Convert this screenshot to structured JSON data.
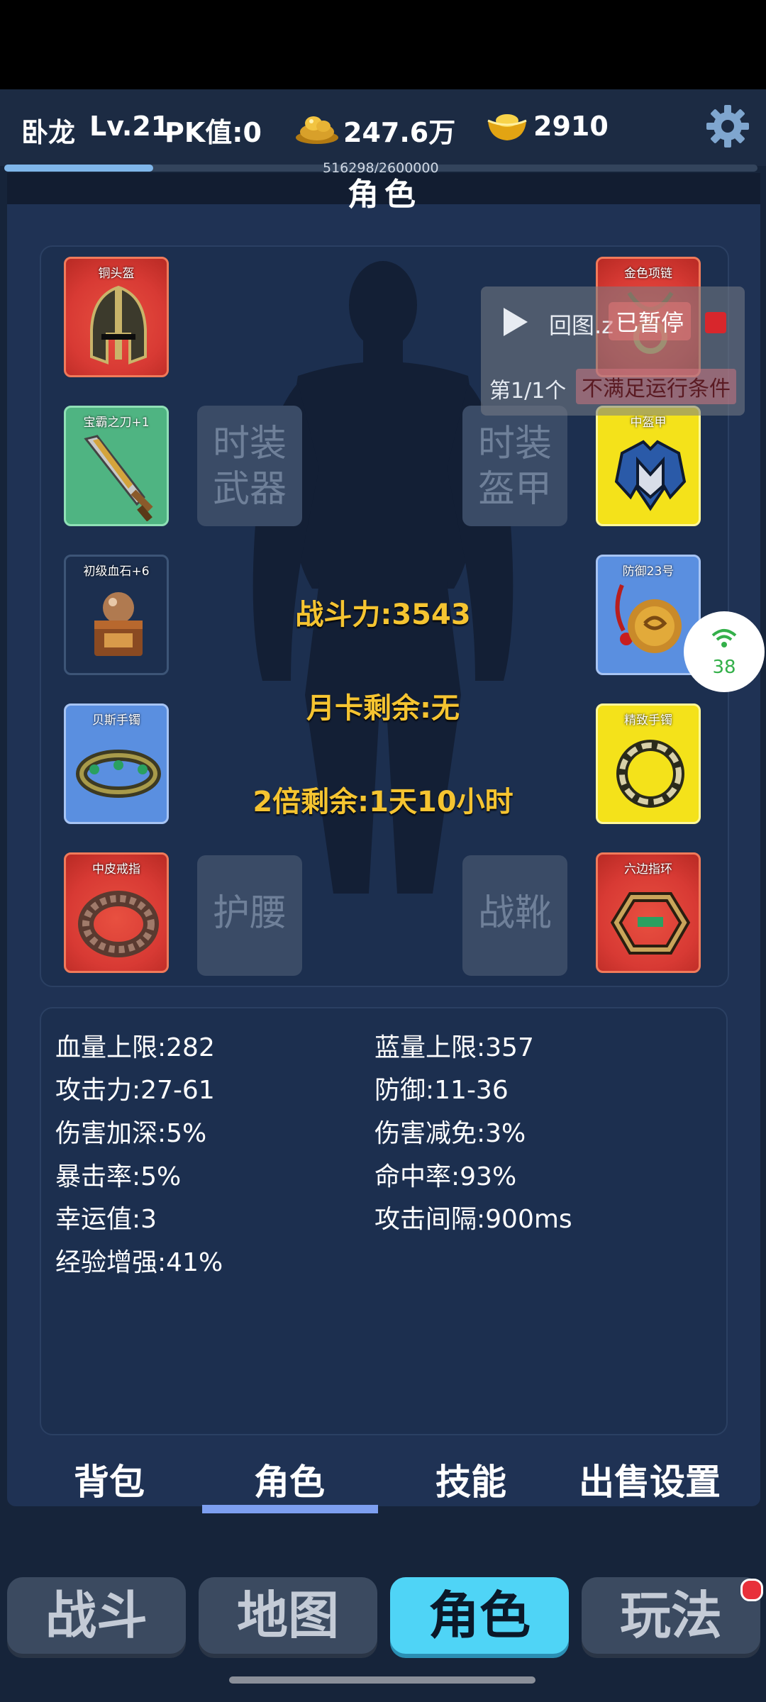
{
  "topbar": {
    "player_name": "卧龙",
    "level": "Lv.21",
    "pk": "PK值:0",
    "gold": "247.6万",
    "ingot": "2910",
    "xp_text": "516298/2600000",
    "xp_progress": 0.198
  },
  "panel": {
    "title": "角色"
  },
  "equipment": {
    "left": [
      {
        "label": "铜头盔",
        "color": "red"
      },
      {
        "label": "宝霸之刀+1",
        "color": "green"
      },
      {
        "label": "初级血石+6",
        "color": "dark"
      },
      {
        "label": "贝斯手镯",
        "color": "blue"
      },
      {
        "label": "中皮戒指",
        "color": "red"
      }
    ],
    "right": [
      {
        "label": "金色项链",
        "color": "red"
      },
      {
        "label": "中盔甲",
        "color": "yellow"
      },
      {
        "label": "防御23号",
        "color": "blue"
      },
      {
        "label": "精致手镯",
        "color": "yellow"
      },
      {
        "label": "六边指环",
        "color": "red"
      }
    ],
    "empty_fashion_weapon": [
      "时装",
      "武器"
    ],
    "empty_fashion_armor": [
      "时装",
      "盔甲"
    ],
    "empty_belt": "护腰",
    "empty_boots": "战靴"
  },
  "center_info": {
    "power": "战斗力:3543",
    "monthly_card": "月卡剩余:无",
    "double_exp": "2倍剩余:1天10小时"
  },
  "stats": {
    "left": [
      "血量上限:282",
      "攻击力:27-61",
      "伤害加深:5%",
      "暴击率:5%",
      "幸运值:3",
      "经验增强:41%"
    ],
    "right": [
      "蓝量上限:357",
      "防御:11-36",
      "伤害减免:3%",
      "命中率:93%",
      "攻击间隔:900ms"
    ]
  },
  "tabs": [
    "背包",
    "角色",
    "技能",
    "出售设置"
  ],
  "nav": [
    "战斗",
    "地图",
    "角色",
    "玩法"
  ],
  "overlay": {
    "script_name": "回图.z",
    "status": "已暂停",
    "progress": "第1/1个",
    "condition": "不满足运行条件"
  },
  "network_badge": {
    "value": "38"
  },
  "colors": {
    "gold_text": "#f5c431",
    "active_nav": "#4fd4f6",
    "tab_underline": "#7d9ff0",
    "slot_red": "#d83a34",
    "slot_green": "#4fb482",
    "slot_blue": "#5a8fe0",
    "slot_yellow": "#f4e21a"
  }
}
